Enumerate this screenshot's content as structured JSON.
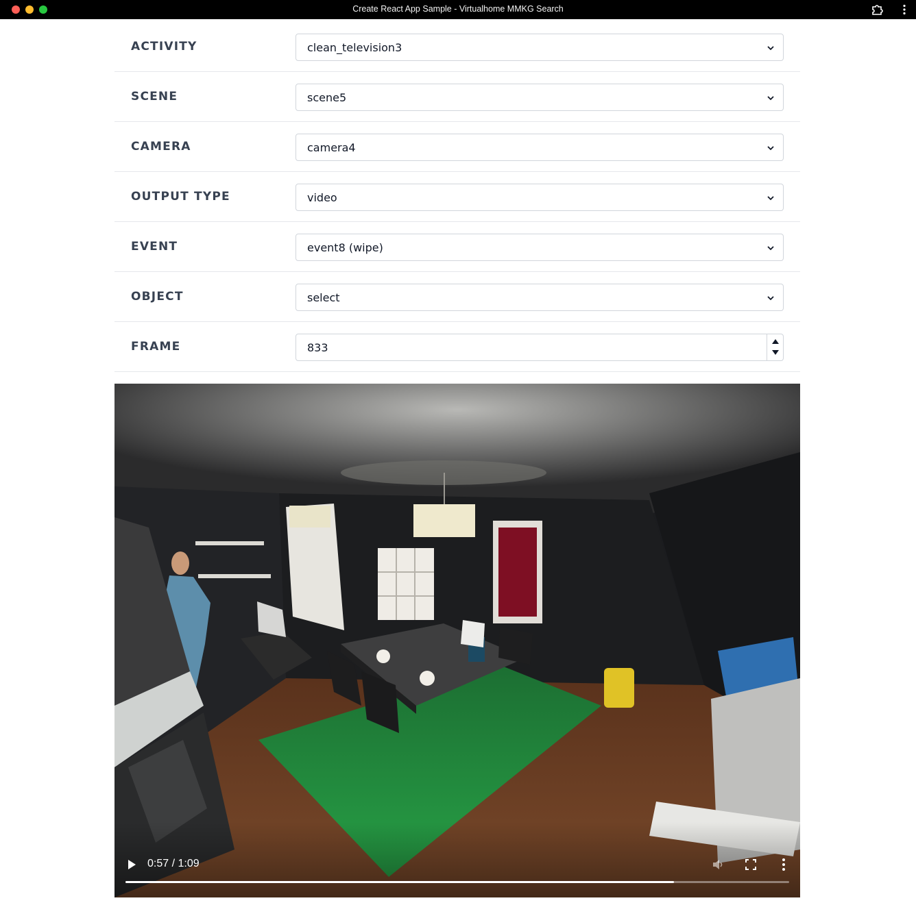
{
  "window": {
    "title": "Create React App Sample - Virtualhome MMKG Search"
  },
  "form": {
    "fields": [
      {
        "label": "ACTIVITY",
        "value": "clean_television3",
        "kind": "select"
      },
      {
        "label": "SCENE",
        "value": "scene5",
        "kind": "select"
      },
      {
        "label": "CAMERA",
        "value": "camera4",
        "kind": "select"
      },
      {
        "label": "OUTPUT TYPE",
        "value": "video",
        "kind": "select"
      },
      {
        "label": "EVENT",
        "value": "event8 (wipe)",
        "kind": "select"
      },
      {
        "label": "OBJECT",
        "value": "select",
        "kind": "select"
      },
      {
        "label": "FRAME",
        "value": "833",
        "kind": "number"
      }
    ]
  },
  "video": {
    "current_time": "0:57",
    "separator": "/",
    "duration": "1:09",
    "progress_fraction": 0.826,
    "icons": {
      "play": "play-icon",
      "volume": "volume-icon",
      "fullscreen": "fullscreen-icon",
      "more": "more-vertical-icon"
    }
  },
  "colors": {
    "label_text": "#374151",
    "border": "#d1d5db",
    "titlebar": "#000000",
    "rug_green": "#1f8a3c",
    "floor_wood": "#6b3d22"
  }
}
